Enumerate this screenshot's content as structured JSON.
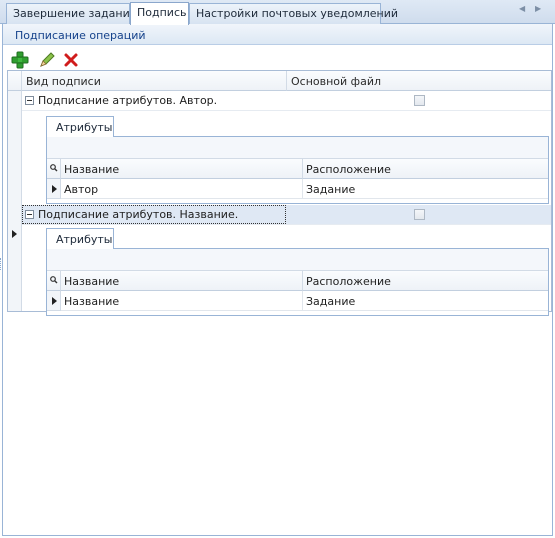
{
  "tabs": [
    {
      "label": "Завершение задания",
      "active": false
    },
    {
      "label": "Подпись",
      "active": true
    },
    {
      "label": "Настройки почтовых уведомлений",
      "active": false
    }
  ],
  "panel": {
    "group_title": "Подписание операций",
    "toolbar": {
      "add_icon": "add-icon",
      "edit_icon": "edit-icon",
      "delete_icon": "delete-icon"
    }
  },
  "grid": {
    "columns": [
      "Вид подписи",
      "Основной файл"
    ],
    "rows": [
      {
        "label": "Подписание атрибутов. Автор.",
        "main_file": false,
        "detail": {
          "tab": "Атрибуты",
          "columns": [
            "Название",
            "Расположение"
          ],
          "rows": [
            {
              "name": "Автор",
              "location": "Задание"
            }
          ]
        }
      },
      {
        "label": "Подписание атрибутов. Название.",
        "main_file": false,
        "detail": {
          "tab": "Атрибуты",
          "columns": [
            "Название",
            "Расположение"
          ],
          "rows": [
            {
              "name": "Название",
              "location": "Задание"
            }
          ]
        }
      }
    ]
  },
  "colors": {
    "accent": "#99b4d6",
    "header_text": "#15428b",
    "add_green": "#2f9e2f",
    "delete_red": "#d01c1c"
  }
}
